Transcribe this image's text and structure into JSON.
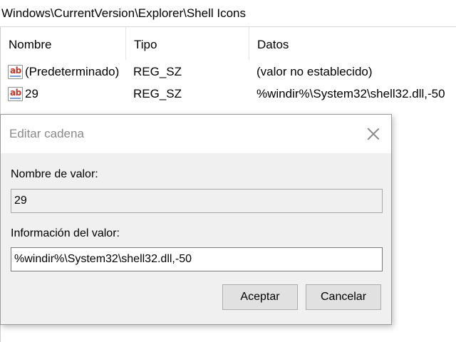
{
  "path": "Windows\\CurrentVersion\\Explorer\\Shell Icons",
  "columns": {
    "name": "Nombre",
    "type": "Tipo",
    "data": "Datos"
  },
  "rows": [
    {
      "name": "(Predeterminado)",
      "type": "REG_SZ",
      "data": "(valor no establecido)",
      "icon": "reg-string-icon"
    },
    {
      "name": "29",
      "type": "REG_SZ",
      "data": "%windir%\\System32\\shell32.dll,-50",
      "icon": "reg-string-icon"
    }
  ],
  "dialog": {
    "title": "Editar cadena",
    "value_name_label": "Nombre de valor:",
    "value_name": "29",
    "value_data_label": "Información del valor:",
    "value_data": "%windir%\\System32\\shell32.dll,-50",
    "ok_label": "Aceptar",
    "cancel_label": "Cancelar"
  },
  "icon_glyph": "ab",
  "colors": {
    "icon_text": "#c0392b",
    "dialog_bg": "#f0f0f0",
    "button_bg": "#e1e1e1"
  }
}
